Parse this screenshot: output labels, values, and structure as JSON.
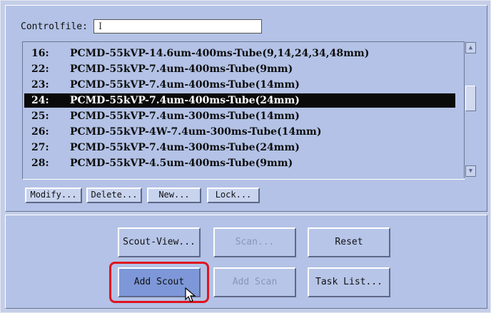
{
  "controlfile": {
    "label": "Controlfile:",
    "value": "",
    "caret_glyph": "I"
  },
  "protocol_list": {
    "selected_index": 3,
    "rows": [
      {
        "num": "16:",
        "name": "PCMD-55kVP-14.6um-400ms-Tube(9,14,24,34,48mm)"
      },
      {
        "num": "22:",
        "name": "PCMD-55kVP-7.4um-400ms-Tube(9mm)"
      },
      {
        "num": "23:",
        "name": "PCMD-55kVP-7.4um-400ms-Tube(14mm)"
      },
      {
        "num": "24:",
        "name": "PCMD-55kVP-7.4um-400ms-Tube(24mm)"
      },
      {
        "num": "25:",
        "name": "PCMD-55kVP-7.4um-300ms-Tube(14mm)"
      },
      {
        "num": "26:",
        "name": "PCMD-55kVP-4W-7.4um-300ms-Tube(14mm)"
      },
      {
        "num": "27:",
        "name": "PCMD-55kVP-7.4um-300ms-Tube(24mm)"
      },
      {
        "num": "28:",
        "name": "PCMD-55kVP-4.5um-400ms-Tube(9mm)"
      }
    ]
  },
  "list_buttons": {
    "modify": "Modify...",
    "delete": "Delete...",
    "new": "New...",
    "lock": "Lock..."
  },
  "action_buttons": {
    "scout_view": "Scout-View...",
    "scan": "Scan...",
    "reset": "Reset",
    "add_scout": "Add Scout",
    "add_scan": "Add Scan",
    "task_list": "Task List..."
  },
  "colors": {
    "panel": "#b3c2e6",
    "selection": "#0a0a0a",
    "highlight_ring": "#e0141e",
    "primary_button": "#7d97d8"
  },
  "icons": {
    "scroll_up": "triangle-up",
    "scroll_down": "triangle-down",
    "cursor": "mouse-pointer"
  }
}
